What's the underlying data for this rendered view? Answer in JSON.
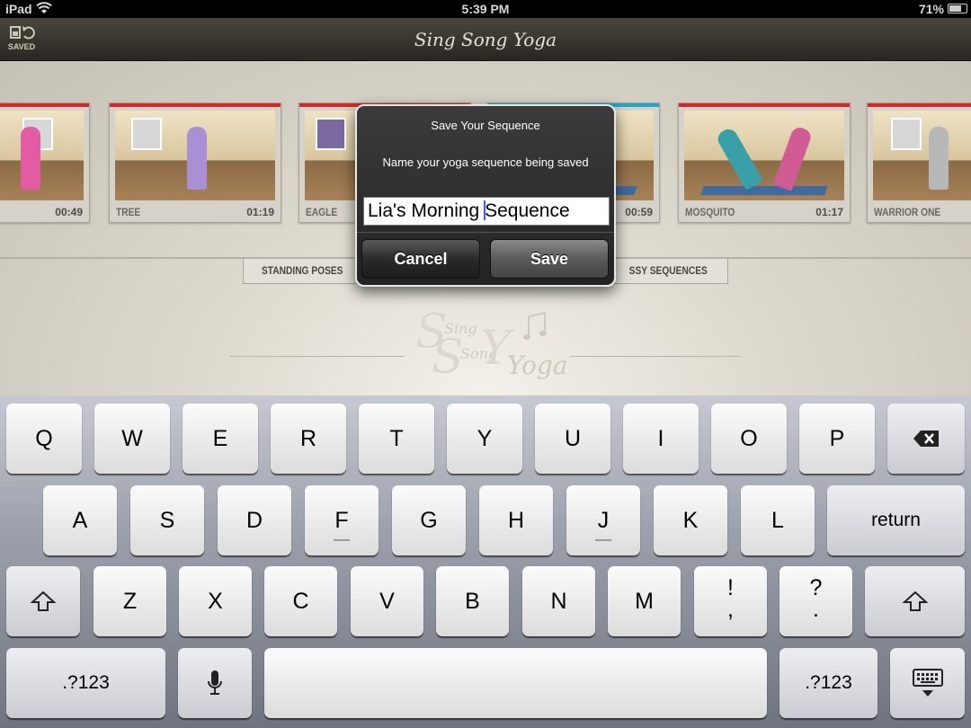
{
  "status_bar": {
    "device": "iPad",
    "time": "5:39 PM",
    "battery": "71%"
  },
  "app": {
    "title": "Sing Song Yoga",
    "saved_label": "SAVED",
    "logo": {
      "sing": "Sing",
      "song": "Song",
      "yoga": "Yoga"
    }
  },
  "cards": [
    {
      "name": "",
      "duration": "00:49",
      "accent": "#d6282c"
    },
    {
      "name": "TREE",
      "duration": "01:19",
      "accent": "#d6282c"
    },
    {
      "name": "EAGLE",
      "duration": "",
      "accent": "#d6282c"
    },
    {
      "name": "",
      "duration": "00:59",
      "accent": "#22a7c7"
    },
    {
      "name": "MOSQUITO",
      "duration": "01:17",
      "accent": "#d6282c"
    },
    {
      "name": "WARRIOR ONE",
      "duration": "",
      "accent": "#d6282c"
    }
  ],
  "tabs": [
    {
      "label": "STANDING POSES"
    },
    {
      "label": "SSY SEQUENCES"
    }
  ],
  "dialog": {
    "title": "Save Your Sequence",
    "message": "Name your yoga sequence being saved",
    "input_before_caret": "Lia's Morning ",
    "input_after_caret": "Sequence",
    "cancel_label": "Cancel",
    "save_label": "Save"
  },
  "keyboard": {
    "row1": [
      "Q",
      "W",
      "E",
      "R",
      "T",
      "Y",
      "U",
      "I",
      "O",
      "P"
    ],
    "row2": [
      "A",
      "S",
      "D",
      "F",
      "G",
      "H",
      "J",
      "K",
      "L"
    ],
    "return_label": "return",
    "row3": [
      "Z",
      "X",
      "C",
      "V",
      "B",
      "N",
      "M"
    ],
    "exclaim_top": "!",
    "exclaim_bottom": ",",
    "question_top": "?",
    "question_bottom": ".",
    "numbers_label": ".?123"
  }
}
